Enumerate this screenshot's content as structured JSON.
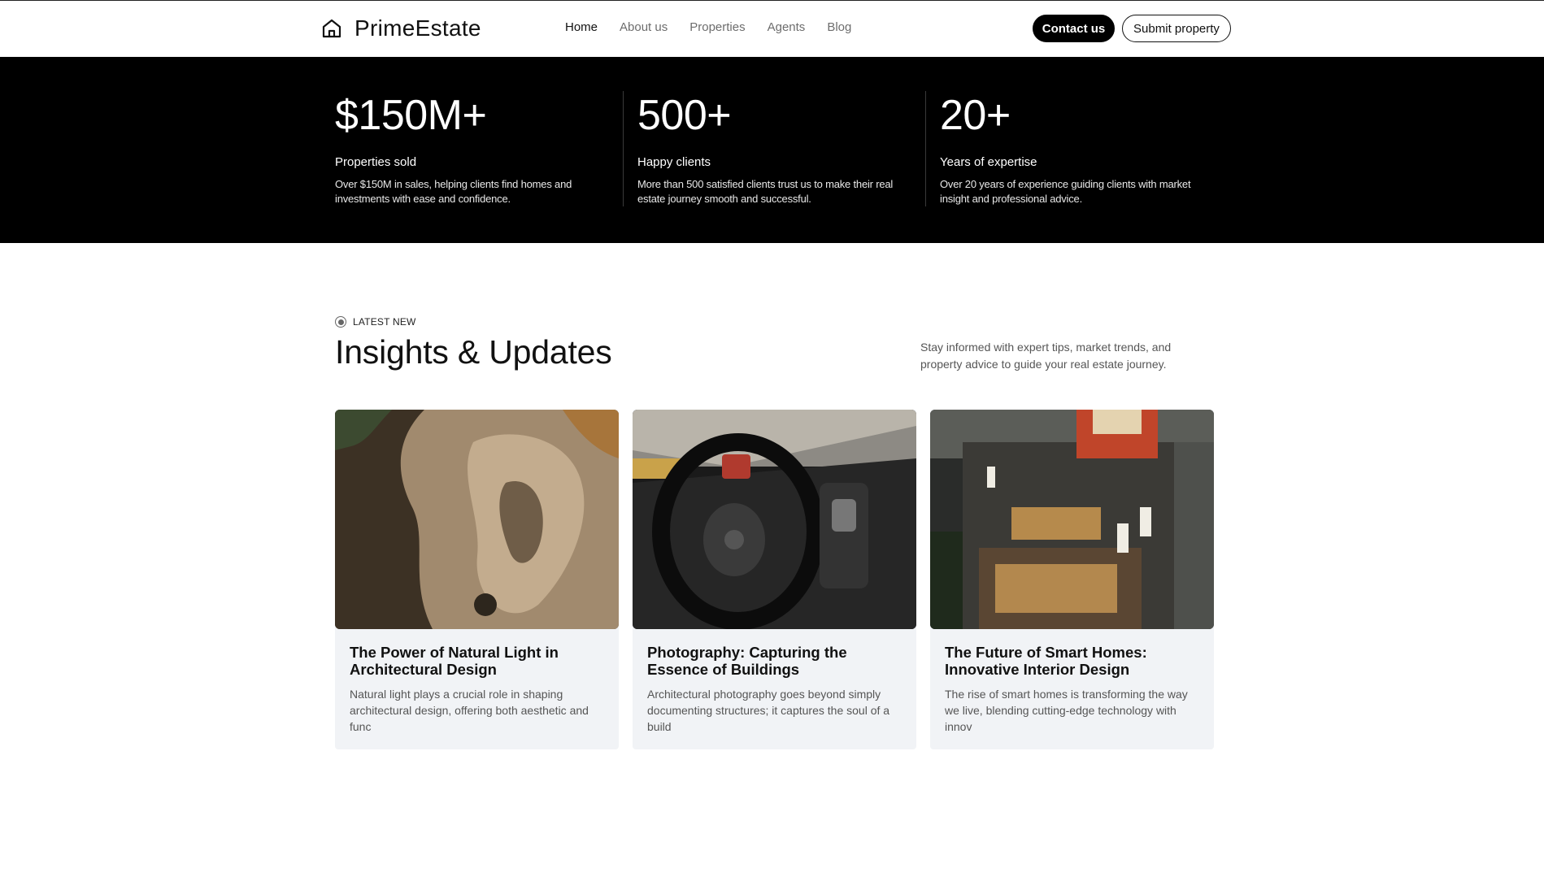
{
  "header": {
    "brand": "PrimeEstate",
    "brand_icon": "home-icon",
    "nav": [
      {
        "label": "Home",
        "active": true
      },
      {
        "label": "About us",
        "active": false
      },
      {
        "label": "Properties",
        "active": false
      },
      {
        "label": "Agents",
        "active": false
      },
      {
        "label": "Blog",
        "active": false
      }
    ],
    "contact_label": "Contact us",
    "submit_label": "Submit property"
  },
  "stats": [
    {
      "value": "$150M+",
      "label": "Properties sold",
      "desc": "Over $150M in sales, helping clients find homes and investments with ease and confidence."
    },
    {
      "value": "500+",
      "label": "Happy clients",
      "desc": "More than 500 satisfied clients trust us to make their real estate journey smooth and successful."
    },
    {
      "value": "20+",
      "label": "Years of expertise",
      "desc": "Over 20 years of experience guiding clients with market insight and professional advice."
    }
  ],
  "insights": {
    "eyebrow": "LATEST NEW",
    "title": "Insights & Updates",
    "subtitle": "Stay informed with expert tips, market trends, and property advice to guide your real estate journey.",
    "posts": [
      {
        "title": "The Power of Natural Light in Architectural Design",
        "excerpt": "Natural light plays a crucial role in shaping architectural design, offering both aesthetic and func"
      },
      {
        "title": "Photography: Capturing the Essence of Buildings",
        "excerpt": "Architectural photography goes beyond simply documenting structures; it captures the soul of a build"
      },
      {
        "title": "The Future of Smart Homes: Innovative Interior Design",
        "excerpt": "The rise of smart homes is transforming the way we live, blending cutting-edge technology with innov"
      }
    ]
  },
  "colors": {
    "accent": "#000000",
    "card_bg": "#f1f3f6",
    "muted_text": "#555555"
  }
}
